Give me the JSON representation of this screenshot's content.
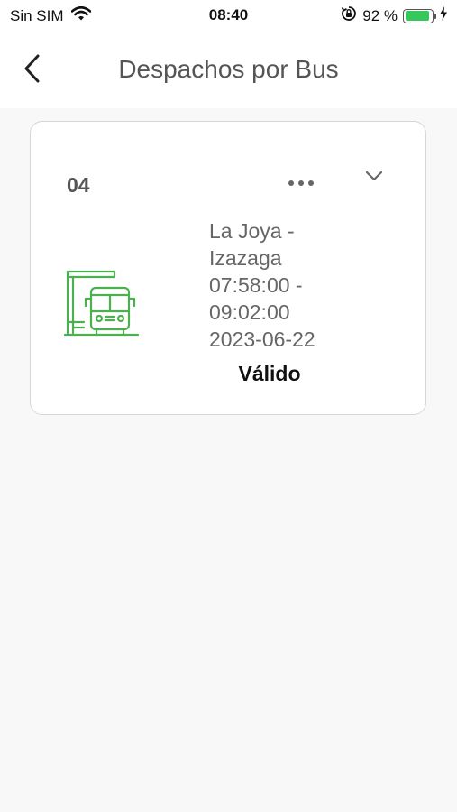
{
  "status_bar": {
    "carrier": "Sin SIM",
    "time": "08:40",
    "battery_percent": "92 %",
    "battery_level": 0.92,
    "battery_color": "#34c759"
  },
  "header": {
    "title": "Despachos por Bus",
    "back_icon": "chevron-left-icon"
  },
  "dispatch_card": {
    "bus_number": "04",
    "more_icon": "more-horizontal-icon",
    "expand_icon": "chevron-down-icon",
    "bus_icon": "bus-stop-icon",
    "icon_color": "#4caf50",
    "route_line1": "La Joya -",
    "route_line2": "Izazaga",
    "time_start": "07:58:00  -",
    "time_end": "09:02:00",
    "date": "2023-06-22",
    "status": "Válido"
  }
}
